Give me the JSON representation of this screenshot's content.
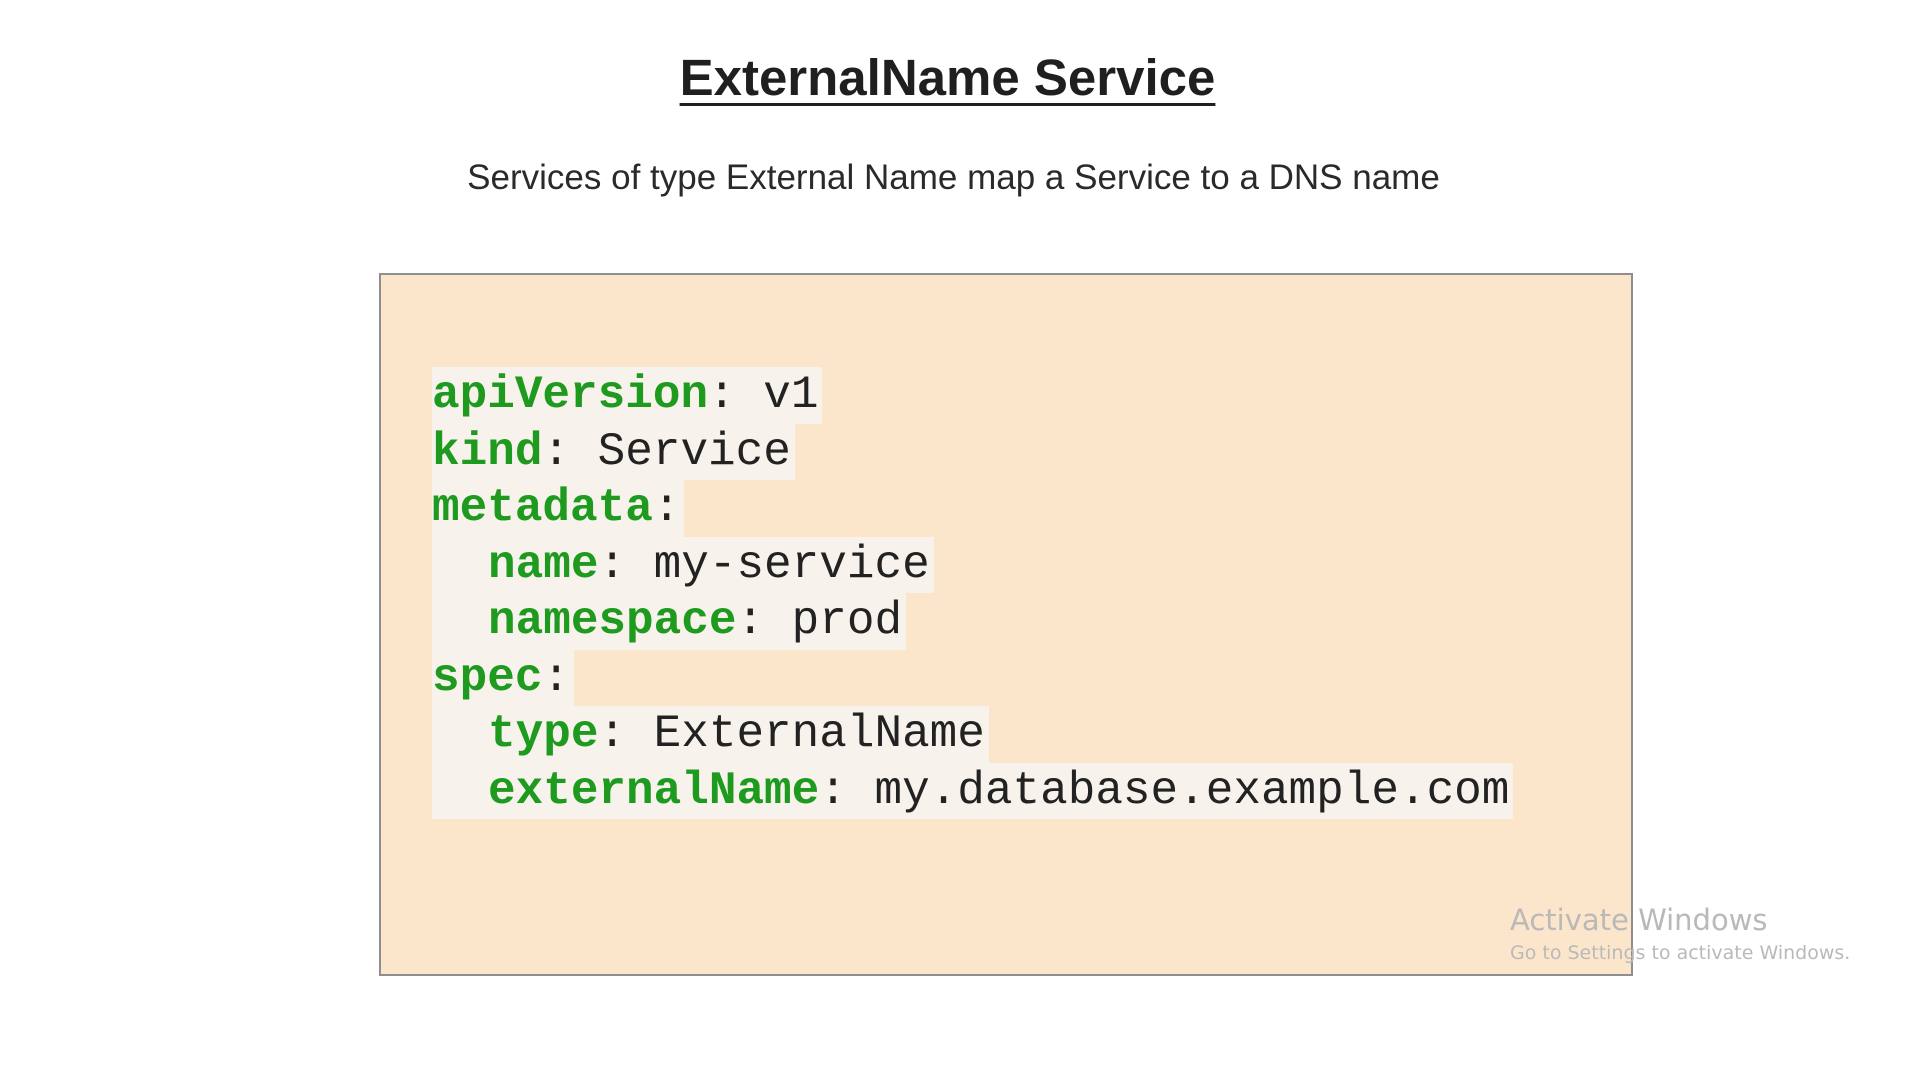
{
  "slide": {
    "title": "ExternalName Service",
    "subtitle": "Services of type External Name map a Service to a DNS name"
  },
  "code": {
    "lines": [
      {
        "indent": 0,
        "key": "apiVersion",
        "sep": ": ",
        "value": "v1"
      },
      {
        "indent": 0,
        "key": "kind",
        "sep": ": ",
        "value": "Service"
      },
      {
        "indent": 0,
        "key": "metadata",
        "sep": ":",
        "value": ""
      },
      {
        "indent": 1,
        "key": "name",
        "sep": ": ",
        "value": "my-service"
      },
      {
        "indent": 1,
        "key": "namespace",
        "sep": ": ",
        "value": "prod"
      },
      {
        "indent": 0,
        "key": "spec",
        "sep": ":",
        "value": ""
      },
      {
        "indent": 1,
        "key": "type",
        "sep": ": ",
        "value": "ExternalName"
      },
      {
        "indent": 1,
        "key": "externalName",
        "sep": ": ",
        "value": "my.database.example.com"
      }
    ],
    "colors": {
      "key": "#1e9a1e",
      "box_background": "#fce6cb"
    }
  },
  "watermark": {
    "title": "Activate Windows",
    "subtitle": "Go to Settings to activate Windows."
  }
}
